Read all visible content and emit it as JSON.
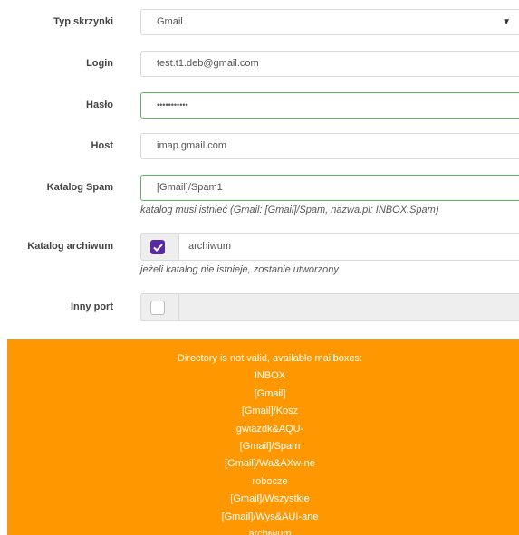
{
  "fields": {
    "mailbox_type": {
      "label": "Typ skrzynki",
      "value": "Gmail",
      "arrow": "▼"
    },
    "login": {
      "label": "Login",
      "value": "test.t1.deb@gmail.com"
    },
    "password": {
      "label": "Hasło",
      "value": "•••••••••••"
    },
    "host": {
      "label": "Host",
      "value": "imap.gmail.com"
    },
    "spam_folder": {
      "label": "Katalog Spam",
      "value": "[Gmail]/Spam1",
      "hint": "katalog musi istnieć (Gmail: [Gmail]/Spam, nazwa.pl: INBOX.Spam)"
    },
    "archive_folder": {
      "label": "Katalog archiwum",
      "checked": true,
      "value": "archiwum",
      "hint": "jeżeli katalog nie istnieje, zostanie utworzony"
    },
    "other_port": {
      "label": "Inny port",
      "checked": false,
      "value": ""
    }
  },
  "alert": {
    "lines": [
      "Directory is not valid, available mailboxes:",
      "INBOX",
      "[Gmail]",
      "[Gmail]/Kosz",
      "gwiazdk&AQU-",
      "[Gmail]/Spam",
      "[Gmail]/Wa&AXw-ne",
      "robocze",
      "[Gmail]/Wszystkie",
      "[Gmail]/Wys&AUI-ane",
      "archiwum"
    ]
  },
  "colors": {
    "alert_bg": "#ff9800",
    "valid_border": "#5cb85c",
    "checkbox_checked": "#5a2aa6"
  }
}
